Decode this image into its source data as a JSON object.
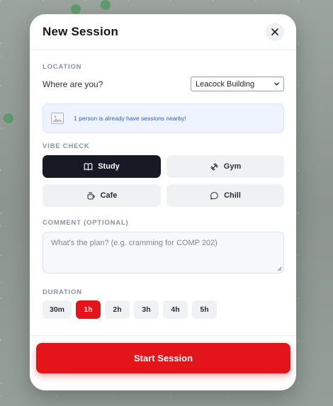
{
  "modal": {
    "title": "New Session"
  },
  "location": {
    "section_label": "LOCATION",
    "question": "Where are you?",
    "selected": "Leacock Building"
  },
  "notice": {
    "text": "1 person is already have sessions nearby!"
  },
  "vibe": {
    "section_label": "VIBE CHECK",
    "options": [
      {
        "label": "Study",
        "icon": "book-icon",
        "active": true
      },
      {
        "label": "Gym",
        "icon": "dumbbell-icon",
        "active": false
      },
      {
        "label": "Cafe",
        "icon": "coffee-cup-icon",
        "active": false
      },
      {
        "label": "Chill",
        "icon": "chat-bubble-icon",
        "active": false
      }
    ]
  },
  "comment": {
    "section_label": "COMMENT (OPTIONAL)",
    "placeholder": "What's the plan? (e.g. cramming for COMP 202)"
  },
  "duration": {
    "section_label": "DURATION",
    "options": [
      "30m",
      "1h",
      "2h",
      "3h",
      "4h",
      "5h"
    ],
    "selected": "1h"
  },
  "submit": {
    "label": "Start Session"
  },
  "colors": {
    "accent": "#e4141b",
    "active_dark": "#161a24",
    "notice_text": "#2c5fc7"
  }
}
